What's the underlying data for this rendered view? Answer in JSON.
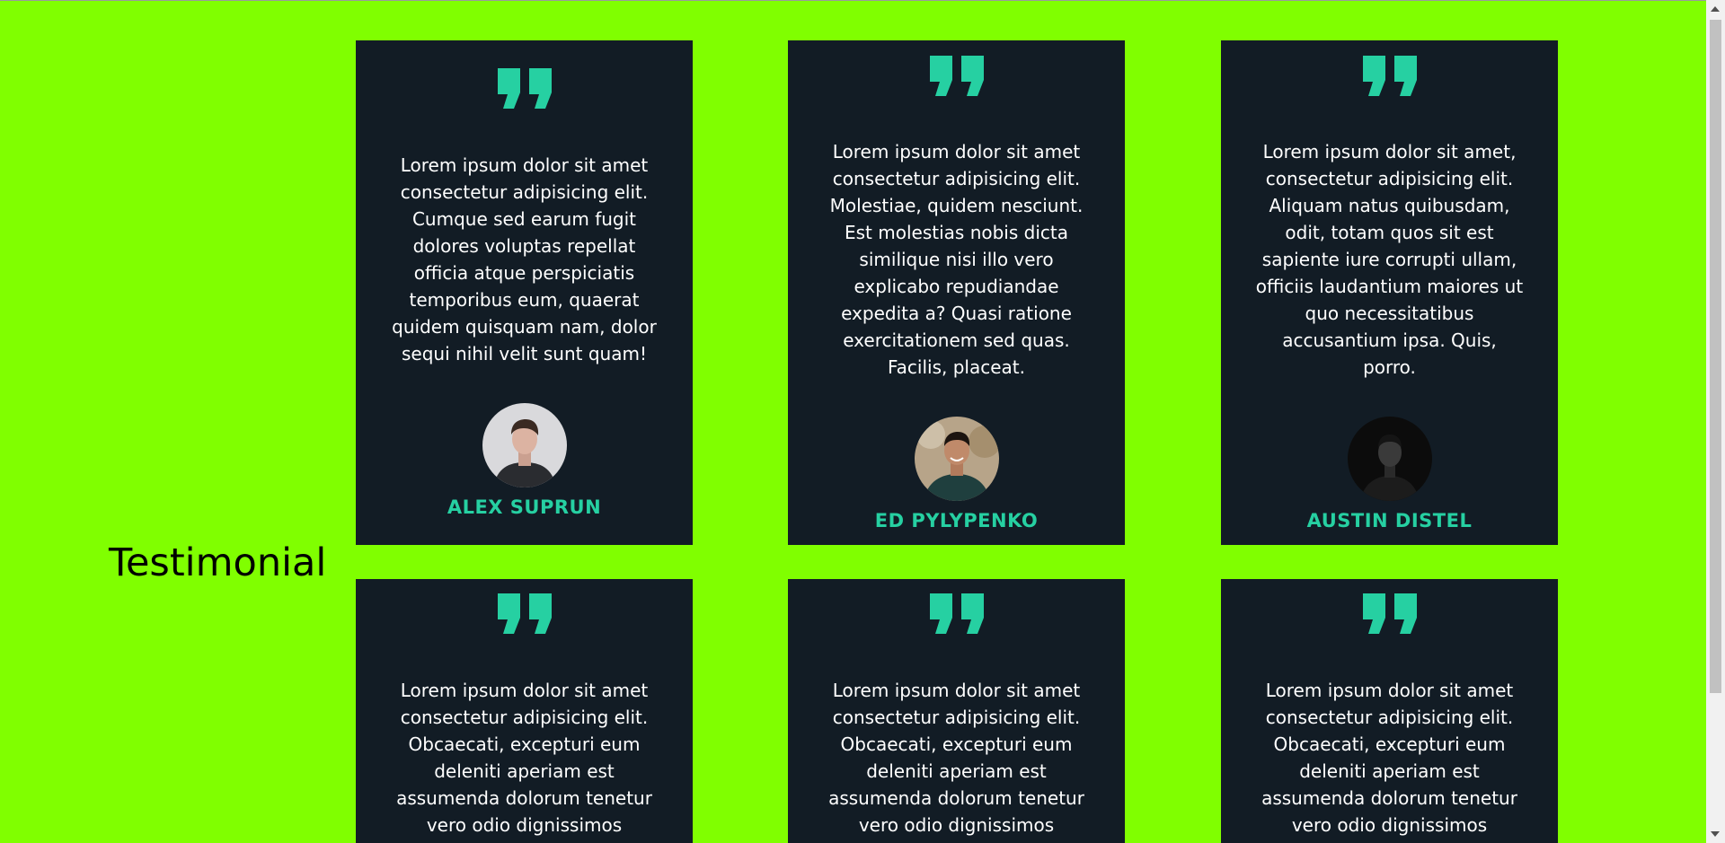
{
  "section": {
    "title": "Testimonial"
  },
  "colors": {
    "background": "#80ff00",
    "card": "#121c25",
    "accent": "#26d0a2",
    "text": "#ffffff"
  },
  "testimonials": [
    {
      "quote_icon": "quote-icon",
      "text": "Lorem ipsum dolor sit amet consectetur adipisicing elit. Cumque sed earum fugit dolores voluptas repellat officia atque perspiciatis temporibus eum, quaerat quidem quisquam nam, dolor sequi nihil velit sunt quam!",
      "name": "ALEX SUPRUN"
    },
    {
      "quote_icon": "quote-icon",
      "text": "Lorem ipsum dolor sit amet consectetur adipisicing elit. Molestiae, quidem nesciunt. Est molestias nobis dicta similique nisi illo vero explicabo repudiandae expedita a? Quasi ratione exercitationem sed quas. Facilis, placeat.",
      "name": "ED PYLYPENKO"
    },
    {
      "quote_icon": "quote-icon",
      "text": "Lorem ipsum dolor sit amet, consectetur adipisicing elit. Aliquam natus quibusdam, odit, totam quos sit est sapiente iure corrupti ullam, officiis laudantium maiores ut quo necessitatibus accusantium ipsa. Quis, porro.",
      "name": "AUSTIN DISTEL"
    },
    {
      "quote_icon": "quote-icon",
      "text": "Lorem ipsum dolor sit amet consectetur adipisicing elit. Obcaecati, excepturi eum deleniti aperiam est assumenda dolorum tenetur vero odio dignissimos"
    },
    {
      "quote_icon": "quote-icon",
      "text": "Lorem ipsum dolor sit amet consectetur adipisicing elit. Obcaecati, excepturi eum deleniti aperiam est assumenda dolorum tenetur vero odio dignissimos"
    },
    {
      "quote_icon": "quote-icon",
      "text": "Lorem ipsum dolor sit amet consectetur adipisicing elit. Obcaecati, excepturi eum deleniti aperiam est assumenda dolorum tenetur vero odio dignissimos"
    }
  ]
}
